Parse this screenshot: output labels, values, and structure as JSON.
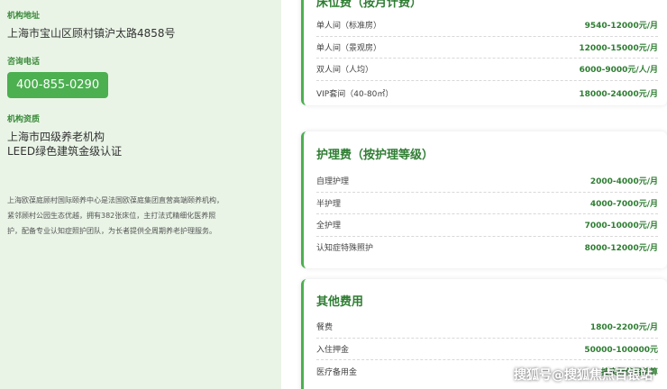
{
  "left": {
    "address_label": "机构地址",
    "address": "上海市宝山区顾村镇沪太路4858号",
    "phone_label": "咨询电话",
    "phone": "400-855-0290",
    "qual_label": "机构资质",
    "qual_1": "上海市四级养老机构",
    "qual_2": "LEED绿色建筑金级认证",
    "desc_1": "上海欧葆庭顾村国际颐养中心是法国欧葆庭集团直营高端颐养机构，",
    "desc_2": "紧邻顾村公园生态优越，拥有382张床位，主打法式精细化医养照",
    "desc_3": "护，配备专业认知症照护团队，为长者提供全周期养老护理服务。"
  },
  "cards": [
    {
      "title": "床位费（按月计费）",
      "rows": [
        {
          "name": "单人间（标准房）",
          "price": "9540-12000元/月"
        },
        {
          "name": "单人间（景观房）",
          "price": "12000-15000元/月"
        },
        {
          "name": "双人间（人均）",
          "price": "6000-9000元/人/月"
        },
        {
          "name": "VIP套间（40-80㎡）",
          "price": "18000-24000元/月"
        }
      ]
    },
    {
      "title": "护理费（按护理等级）",
      "rows": [
        {
          "name": "自理护理",
          "price": "2000-4000元/月"
        },
        {
          "name": "半护理",
          "price": "4000-7000元/月"
        },
        {
          "name": "全护理",
          "price": "7000-10000元/月"
        },
        {
          "name": "认知症特殊照护",
          "price": "8000-12000元/月"
        }
      ]
    },
    {
      "title": "其他费用",
      "rows": [
        {
          "name": "餐费",
          "price": "1800-2200元/月"
        },
        {
          "name": "入住押金",
          "price": "50000-100000元"
        },
        {
          "name": "医疗备用金",
          "price": "按实际使用结算"
        }
      ]
    }
  ],
  "watermark": "搜狐号@搜狐焦点百银站"
}
